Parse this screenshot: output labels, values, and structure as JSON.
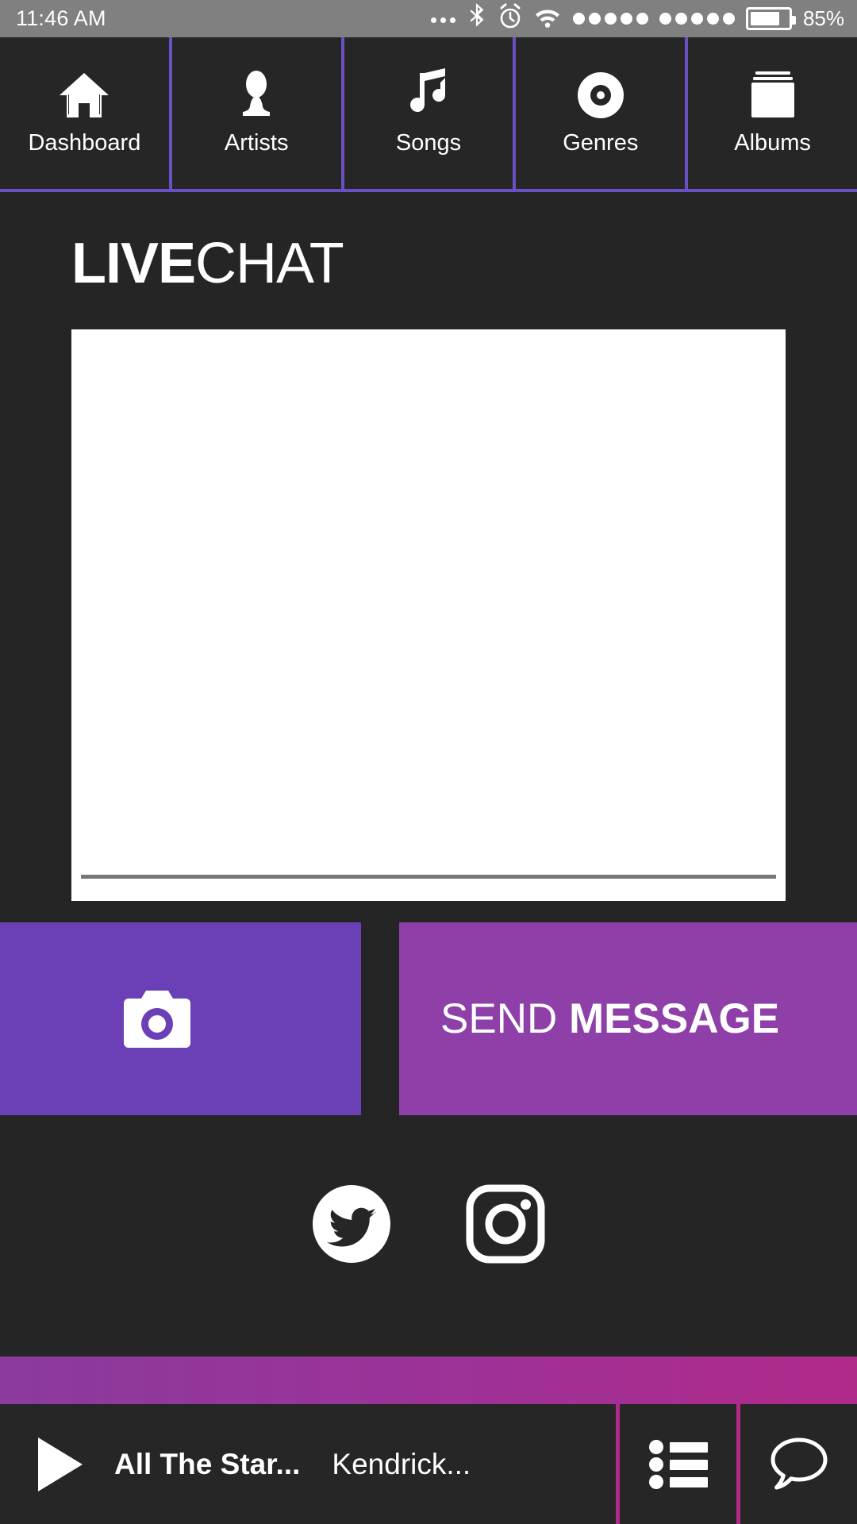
{
  "status_bar": {
    "time": "11:46 AM",
    "battery_percent": "85%",
    "icons": [
      "more-dots-icon",
      "bluetooth-icon",
      "alarm-icon",
      "wifi-icon",
      "signal-sim1-icon",
      "signal-sim2-icon",
      "battery-icon"
    ]
  },
  "tabs": [
    {
      "label": "Dashboard",
      "icon": "home-icon"
    },
    {
      "label": "Artists",
      "icon": "person-icon"
    },
    {
      "label": "Songs",
      "icon": "music-note-icon"
    },
    {
      "label": "Genres",
      "icon": "vinyl-record-icon"
    },
    {
      "label": "Albums",
      "icon": "albums-icon"
    }
  ],
  "screen": {
    "title_bold": "LIVE",
    "title_regular": "CHAT",
    "message_input": {
      "value": "",
      "placeholder": ""
    }
  },
  "actions": {
    "camera_label": "",
    "camera_icon": "camera-icon",
    "send_light": "SEND",
    "send_bold": "MESSAGE"
  },
  "social": [
    {
      "name": "twitter-icon"
    },
    {
      "name": "instagram-icon"
    }
  ],
  "player": {
    "play_icon": "play-icon",
    "track_title": "All The Star...",
    "track_artist": "Kendrick...",
    "playlist_icon": "playlist-icon",
    "chat_icon": "chat-bubble-icon"
  },
  "colors": {
    "accent_purple": "#6b4fc4",
    "camera_purple": "#6b3fb5",
    "send_purple": "#8e3fa8",
    "magenta": "#b02a8a",
    "background": "#252525",
    "panel": "#262626",
    "status_bar": "#808080"
  }
}
